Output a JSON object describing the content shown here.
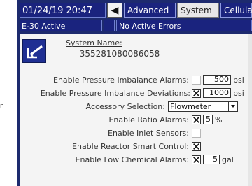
{
  "header": {
    "datetime": "01/24/19 20:47",
    "back_icon": "left-arrow-icon",
    "tabs": [
      {
        "label": "Advanced",
        "active": false
      },
      {
        "label": "System",
        "active": true
      },
      {
        "label": "Cellular",
        "active": false
      }
    ]
  },
  "status": {
    "mode": "E-30 Active",
    "errors": "No Active Errors"
  },
  "system": {
    "name_label": "System Name:",
    "name_value": "355281080086058",
    "icon": "edit-icon"
  },
  "settings": {
    "pressure_imbalance_alarms": {
      "label": "Enable Pressure Imbalance Alarms:",
      "value": "500",
      "unit": "psi",
      "enabled": false
    },
    "pressure_imbalance_deviations": {
      "label": "Enable Pressure Imbalance Deviations:",
      "value": "1000",
      "unit": "psi",
      "enabled": true
    },
    "accessory_selection": {
      "label": "Accessory Selection:",
      "value": "Flowmeter"
    },
    "ratio_alarms": {
      "label": "Enable Ratio Alarms:",
      "value": "5",
      "unit": "%",
      "enabled": true
    },
    "inlet_sensors": {
      "label": "Enable Inlet Sensors:",
      "enabled": false
    },
    "reactor_smart_control": {
      "label": "Enable Reactor Smart Control:",
      "enabled": true
    },
    "low_chemical_alarms": {
      "label": "Enable Low Chemical Alarms:",
      "value": "5",
      "unit": "gal",
      "enabled": true
    }
  },
  "callout": {
    "text": "n"
  },
  "colors": {
    "screen_blue": "#1d2a6e",
    "tab_blue": "#1a237e",
    "panel": "#f4f4f4"
  }
}
